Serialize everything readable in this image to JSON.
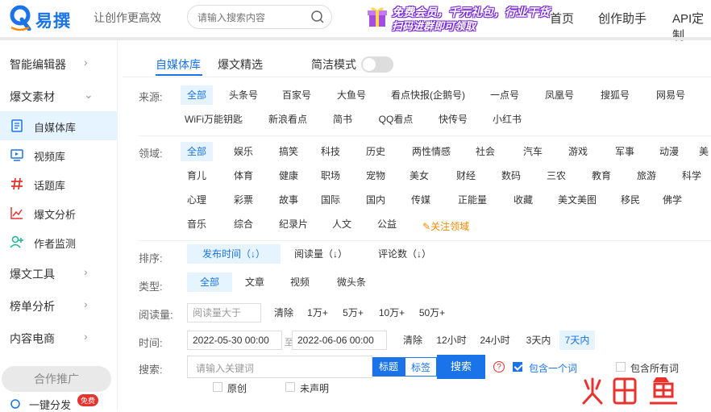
{
  "header": {
    "logo_text": "易撰",
    "slogan": "让创作更高效",
    "search_placeholder": "请输入搜索内容",
    "promo_line1": "免费会员，千元礼包，行业干货",
    "promo_line2": "扫码进群即可领取",
    "nav": [
      "首页",
      "创作助手",
      "API定制"
    ]
  },
  "sidebar": {
    "items": [
      {
        "label": "智能编辑器",
        "chevron": "›"
      },
      {
        "label": "爆文素材",
        "chevron": "⌄"
      }
    ],
    "sub_items": [
      {
        "label": "自媒体库",
        "icon": "document-icon"
      },
      {
        "label": "视频库",
        "icon": "video-icon"
      },
      {
        "label": "话题库",
        "icon": "hashtag-icon"
      },
      {
        "label": "爆文分析",
        "icon": "chart-line-icon"
      },
      {
        "label": "作者监测",
        "icon": "user-add-icon"
      }
    ],
    "more_items": [
      {
        "label": "爆文工具",
        "chevron": "›"
      },
      {
        "label": "榜单分析",
        "chevron": "›"
      },
      {
        "label": "内容电商",
        "chevron": "›"
      }
    ],
    "coop_label": "合作推广",
    "oneclick_label": "一键分发",
    "free_badge": "免费"
  },
  "tabs": {
    "items": [
      "自媒体库",
      "爆文精选"
    ],
    "simple_mode_label": "简洁模式"
  },
  "filters": {
    "source_label": "来源:",
    "sources_row1": [
      "全部",
      "头条号",
      "百家号",
      "大鱼号",
      "看点快报(企鹅号)",
      "一点号",
      "凤凰号",
      "搜狐号",
      "网易号"
    ],
    "sources_row2": [
      "WiFi万能钥匙",
      "新浪看点",
      "简书",
      "QQ看点",
      "快传号",
      "小红书"
    ],
    "field_label": "领域:",
    "fields_row1": [
      "全部",
      "娱乐",
      "搞笑",
      "科技",
      "历史",
      "两性情感",
      "社会",
      "汽车",
      "游戏",
      "军事",
      "动漫",
      "美"
    ],
    "fields_row2": [
      "育儿",
      "体育",
      "健康",
      "职场",
      "宠物",
      "美女",
      "财经",
      "数码",
      "三农",
      "教育",
      "旅游",
      "科学"
    ],
    "fields_row3": [
      "心理",
      "彩票",
      "故事",
      "国际",
      "国内",
      "传媒",
      "正能量",
      "收藏",
      "美文美图",
      "移民",
      "佛学"
    ],
    "fields_row4": [
      "音乐",
      "综合",
      "纪录片",
      "人文",
      "公益"
    ],
    "follow_field": "关注领域",
    "sort_label": "排序:",
    "sorts": [
      "发布时间（↓）",
      "阅读量（↓）",
      "评论数（↓）"
    ],
    "type_label": "类型:",
    "types": [
      "全部",
      "文章",
      "视频",
      "微头条"
    ],
    "reads_label": "阅读量:",
    "reads_placeholder": "阅读量大于",
    "reads_options": [
      "清除",
      "1万+",
      "5万+",
      "10万+",
      "50万+"
    ],
    "time_label": "时间:",
    "time_start": "2022-05-30 00:00",
    "time_sep": "至",
    "time_end": "2022-06-06 00:00",
    "time_options": [
      "清除",
      "12小时",
      "24小时",
      "3天内",
      "7天内"
    ],
    "search_label": "搜索:",
    "keyword_placeholder": "请输入关键词",
    "seg_title": "标题",
    "seg_tag": "标签",
    "search_button": "搜索",
    "include_one": "包含一个词",
    "include_all": "包含所有词",
    "original": "原创",
    "undeclared": "未声明"
  },
  "colors": {
    "accent": "#1a73e8",
    "selected_bg": "#e6f4ff",
    "badge": "#e8322d",
    "follow": "#f08a00"
  }
}
